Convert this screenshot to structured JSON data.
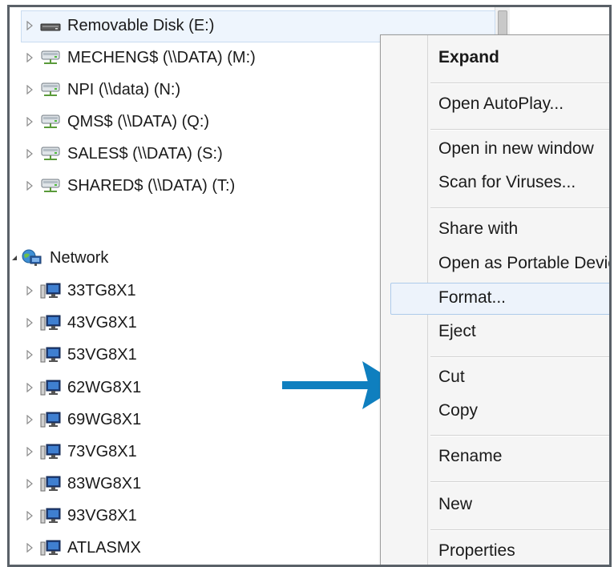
{
  "drives": [
    {
      "label": "Removable Disk (E:)",
      "icon": "removable-disk-icon"
    },
    {
      "label": "MECHENG$ (\\\\DATA) (M:)",
      "icon": "network-drive-icon"
    },
    {
      "label": "NPI (\\\\data) (N:)",
      "icon": "network-drive-icon"
    },
    {
      "label": "QMS$ (\\\\DATA) (Q:)",
      "icon": "network-drive-icon"
    },
    {
      "label": "SALES$ (\\\\DATA) (S:)",
      "icon": "network-drive-icon"
    },
    {
      "label": "SHARED$ (\\\\DATA) (T:)",
      "icon": "network-drive-icon"
    }
  ],
  "network": {
    "label": "Network",
    "icon": "network-globe-icon",
    "computers": [
      "33TG8X1",
      "43VG8X1",
      "53VG8X1",
      "62WG8X1",
      "69WG8X1",
      "73VG8X1",
      "83WG8X1",
      "93VG8X1",
      "ATLASMX"
    ]
  },
  "context_menu": {
    "items": [
      {
        "label": "Expand",
        "bold": true
      },
      {
        "label": "Open AutoPlay..."
      },
      {
        "label": "Open in new window"
      },
      {
        "label": "Scan for Viruses..."
      },
      {
        "label": "Share with"
      },
      {
        "label": "Open as Portable Devic"
      },
      {
        "label": "Format...",
        "highlighted": true
      },
      {
        "label": "Eject"
      },
      {
        "label": "Cut"
      },
      {
        "label": "Copy"
      },
      {
        "label": "Rename"
      },
      {
        "label": "New"
      },
      {
        "label": "Properties"
      }
    ]
  },
  "colors": {
    "arrow": "#0f7fbf",
    "selection": "#eef5fd",
    "menu_bg": "#f5f5f5"
  }
}
